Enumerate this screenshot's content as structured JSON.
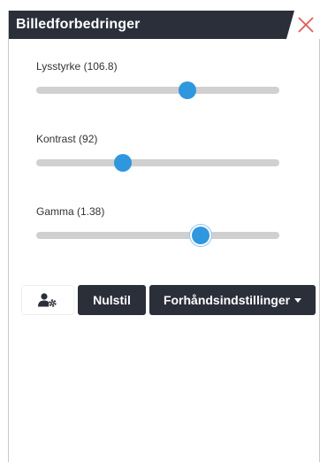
{
  "panel": {
    "title": "Billedforbedringer",
    "close_icon": "close-icon"
  },
  "sliders": [
    {
      "label": "Lysstyrke (106.8)",
      "value": 106.8,
      "fill_fraction": 0.62
    },
    {
      "label": "Kontrast (92)",
      "value": 92,
      "fill_fraction": 0.355
    },
    {
      "label": "Gamma (1.38)",
      "value": 1.38,
      "fill_fraction": 0.675
    }
  ],
  "toolbar": {
    "settings_icon": "user-gear-icon",
    "reset_label": "Nulstil",
    "presets_label": "Forhåndsindstillinger"
  },
  "colors": {
    "header_bg": "#2b2f3a",
    "accent": "#2f97de",
    "close": "#e05a5a"
  }
}
